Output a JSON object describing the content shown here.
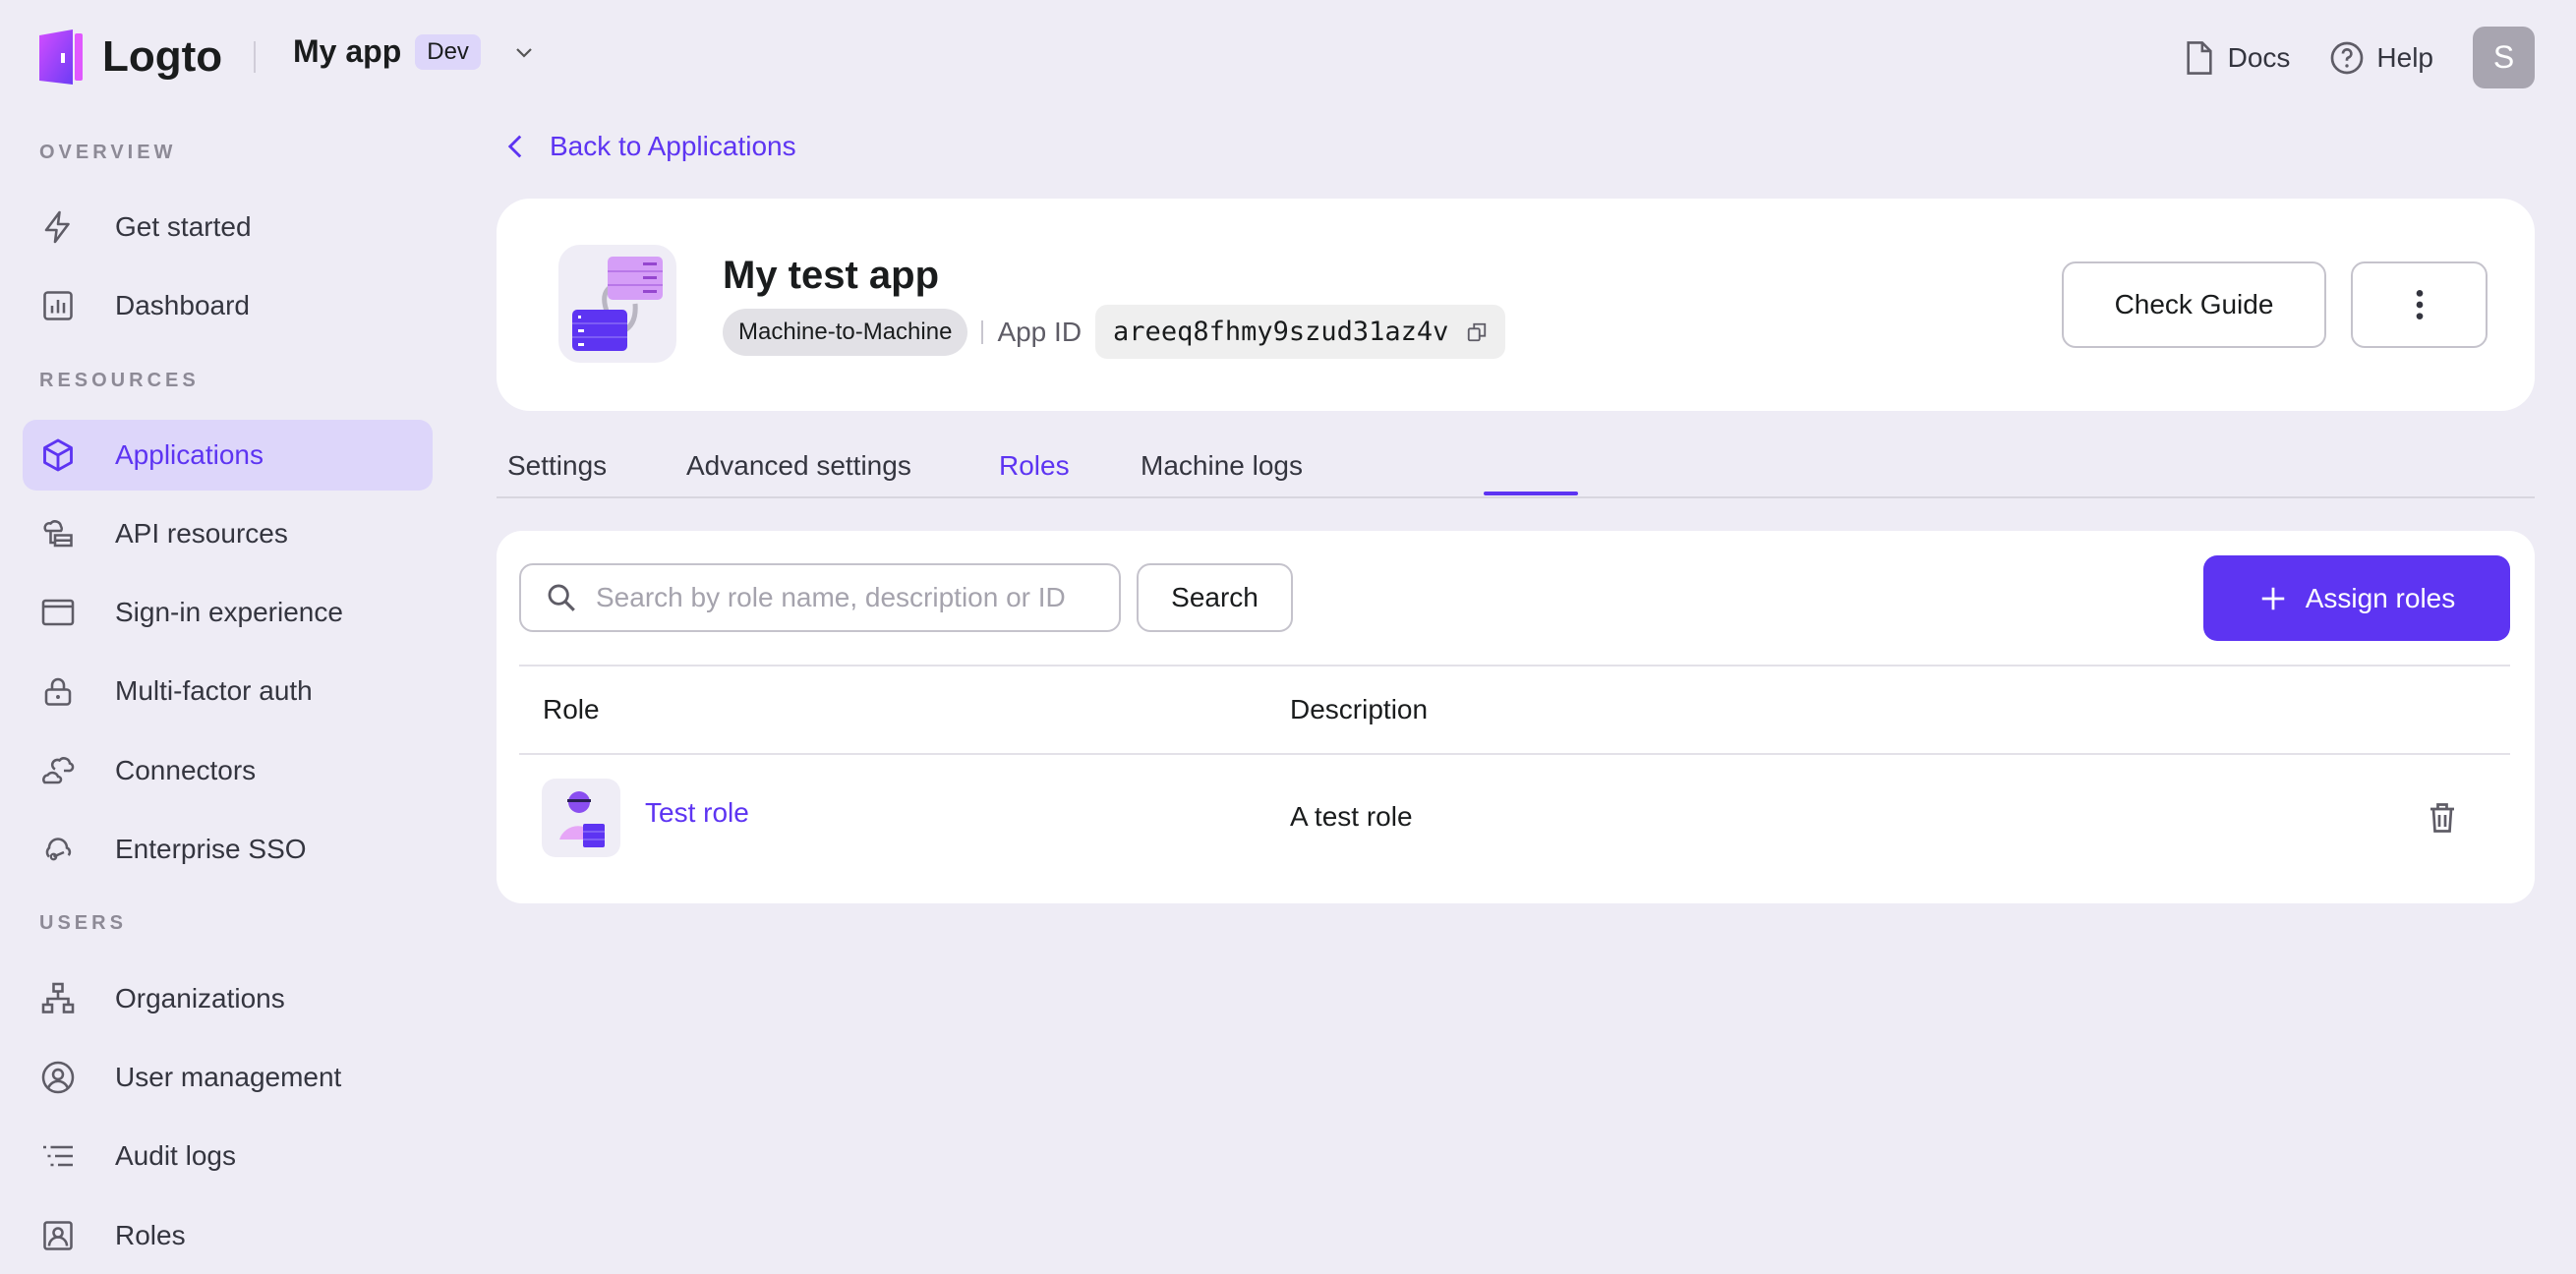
{
  "topbar": {
    "brand": "Logto",
    "tenant": "My app",
    "tenant_badge": "Dev",
    "docs": "Docs",
    "help": "Help",
    "avatar": "S"
  },
  "sidebar": {
    "sections": [
      {
        "label": "OVERVIEW",
        "items": [
          {
            "label": "Get started",
            "icon": "lightning-icon"
          },
          {
            "label": "Dashboard",
            "icon": "chart-icon"
          }
        ]
      },
      {
        "label": "RESOURCES",
        "items": [
          {
            "label": "Applications",
            "icon": "cube-icon",
            "active": true
          },
          {
            "label": "API resources",
            "icon": "cloud-db-icon"
          },
          {
            "label": "Sign-in experience",
            "icon": "browser-icon"
          },
          {
            "label": "Multi-factor auth",
            "icon": "lock-icon"
          },
          {
            "label": "Connectors",
            "icon": "clouds-icon"
          },
          {
            "label": "Enterprise SSO",
            "icon": "cloud-key-icon"
          }
        ]
      },
      {
        "label": "USERS",
        "items": [
          {
            "label": "Organizations",
            "icon": "org-icon"
          },
          {
            "label": "User management",
            "icon": "user-circle-icon"
          },
          {
            "label": "Audit logs",
            "icon": "list-icon"
          },
          {
            "label": "Roles",
            "icon": "user-card-icon"
          }
        ]
      }
    ]
  },
  "main": {
    "back_link": "Back to Applications",
    "app": {
      "name": "My test app",
      "type": "Machine-to-Machine",
      "app_id_label": "App ID",
      "app_id": "areeq8fhmy9szud31az4v",
      "check_guide": "Check Guide"
    },
    "tabs": [
      {
        "label": "Settings"
      },
      {
        "label": "Advanced settings"
      },
      {
        "label": "Roles",
        "active": true
      },
      {
        "label": "Machine logs"
      }
    ],
    "roles": {
      "search_placeholder": "Search by role name, description or ID",
      "search_value": "",
      "search_button": "Search",
      "assign_button": "Assign roles",
      "columns": [
        "Role",
        "Description"
      ],
      "rows": [
        {
          "role": "Test role",
          "description": "A test role"
        }
      ]
    }
  },
  "colors": {
    "accent": "#5d34f2",
    "background": "#eeecf5",
    "active_nav": "#ddd6fa"
  }
}
